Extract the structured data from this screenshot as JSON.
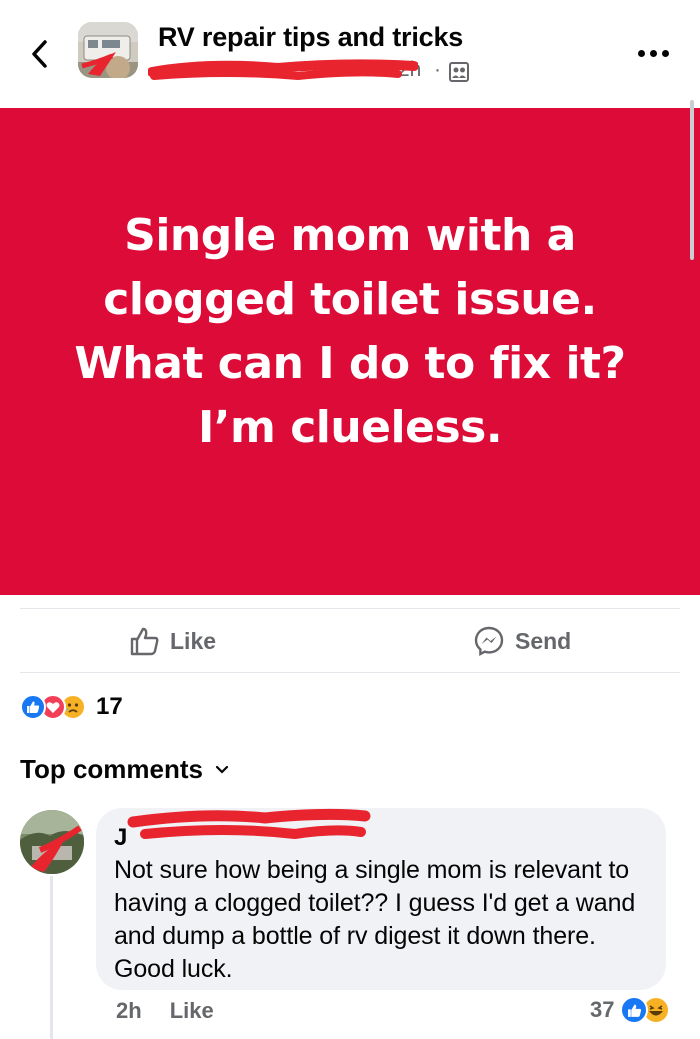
{
  "header": {
    "group_name": "RV repair tips and tricks",
    "time": "2h",
    "separator": "·"
  },
  "post": {
    "text": "Single mom with a clogged toilet issue. What can I do to fix it? I’m clueless.",
    "background_color": "#dc0b37",
    "like_label": "Like",
    "send_label": "Send",
    "reaction_count": "17",
    "reactions": [
      "like-icon",
      "love-icon",
      "sad-icon"
    ]
  },
  "comments_section": {
    "label": "Top comments"
  },
  "comment": {
    "name_visible": "J",
    "text": "Not sure how being a single mom is relevant to having a clogged toilet?? I guess I'd get a wand and dump a bottle of rv digest it down there. Good luck.",
    "time": "2h",
    "like_label": "Like",
    "reaction_count": "37",
    "reactions": [
      "like-icon",
      "haha-icon"
    ]
  },
  "colors": {
    "accent_blue": "#1877f2",
    "redaction": "#e8252f",
    "muted_text": "#65676b"
  }
}
